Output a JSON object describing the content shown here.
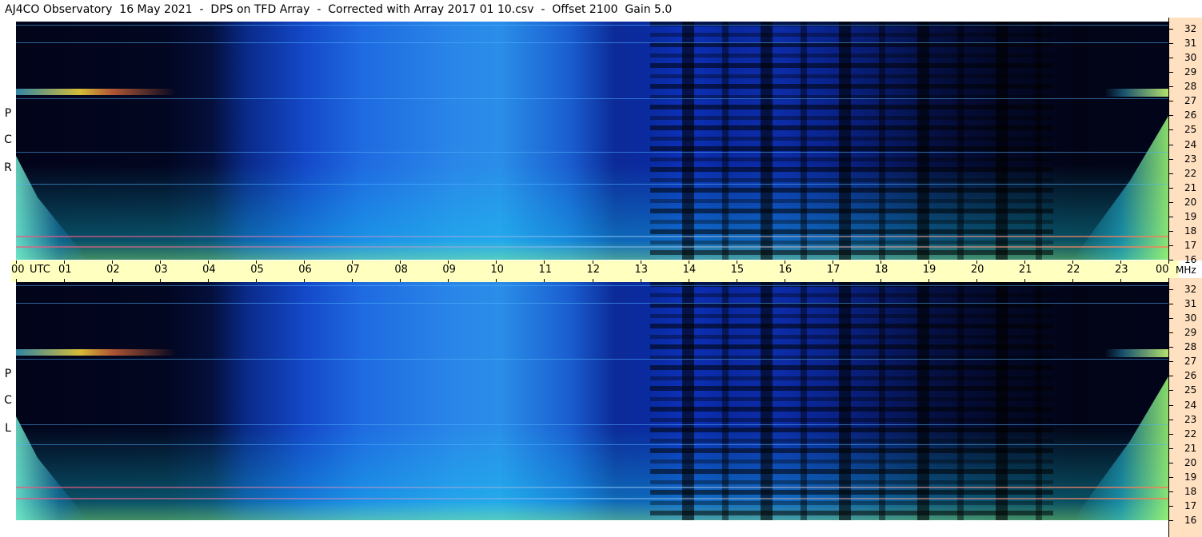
{
  "title": "AJ4CO Observatory  16 May 2021  -  DPS on TFD Array  -  Corrected with Array 2017 01 10.csv  -  Offset 2100  Gain 5.0",
  "chart_data": [
    {
      "type": "heatmap",
      "polarization": [
        "R",
        "C",
        "P"
      ],
      "x_label": "UTC",
      "x_ticks": [
        "00",
        "01",
        "02",
        "03",
        "04",
        "05",
        "06",
        "07",
        "08",
        "09",
        "10",
        "11",
        "12",
        "13",
        "14",
        "15",
        "16",
        "17",
        "18",
        "19",
        "20",
        "21",
        "22",
        "23",
        "00"
      ],
      "y_unit": "MHz",
      "y_ticks": [
        32,
        31,
        30,
        29,
        28,
        27,
        26,
        25,
        24,
        23,
        22,
        21,
        20,
        19,
        18,
        17,
        16
      ],
      "ylim": [
        16,
        32.5
      ]
    },
    {
      "type": "heatmap",
      "polarization": [
        "L",
        "C",
        "P"
      ],
      "x_label": "UTC",
      "x_ticks": [
        "00",
        "01",
        "02",
        "03",
        "04",
        "05",
        "06",
        "07",
        "08",
        "09",
        "10",
        "11",
        "12",
        "13",
        "14",
        "15",
        "16",
        "17",
        "18",
        "19",
        "20",
        "21",
        "22",
        "23",
        "00"
      ],
      "y_unit": "MHz",
      "y_ticks": [
        32,
        31,
        30,
        29,
        28,
        27,
        26,
        25,
        24,
        23,
        22,
        21,
        20,
        19,
        18,
        17,
        16
      ],
      "ylim": [
        16,
        32.5
      ]
    }
  ],
  "colors": {
    "time_axis_bg": "#ffffc0",
    "freq_axis_bg": "#ffe0c0",
    "spectrogram_low": "#02041a",
    "spectrogram_mid": "#1f6ae0",
    "spectrogram_high": "#78ffa0"
  }
}
